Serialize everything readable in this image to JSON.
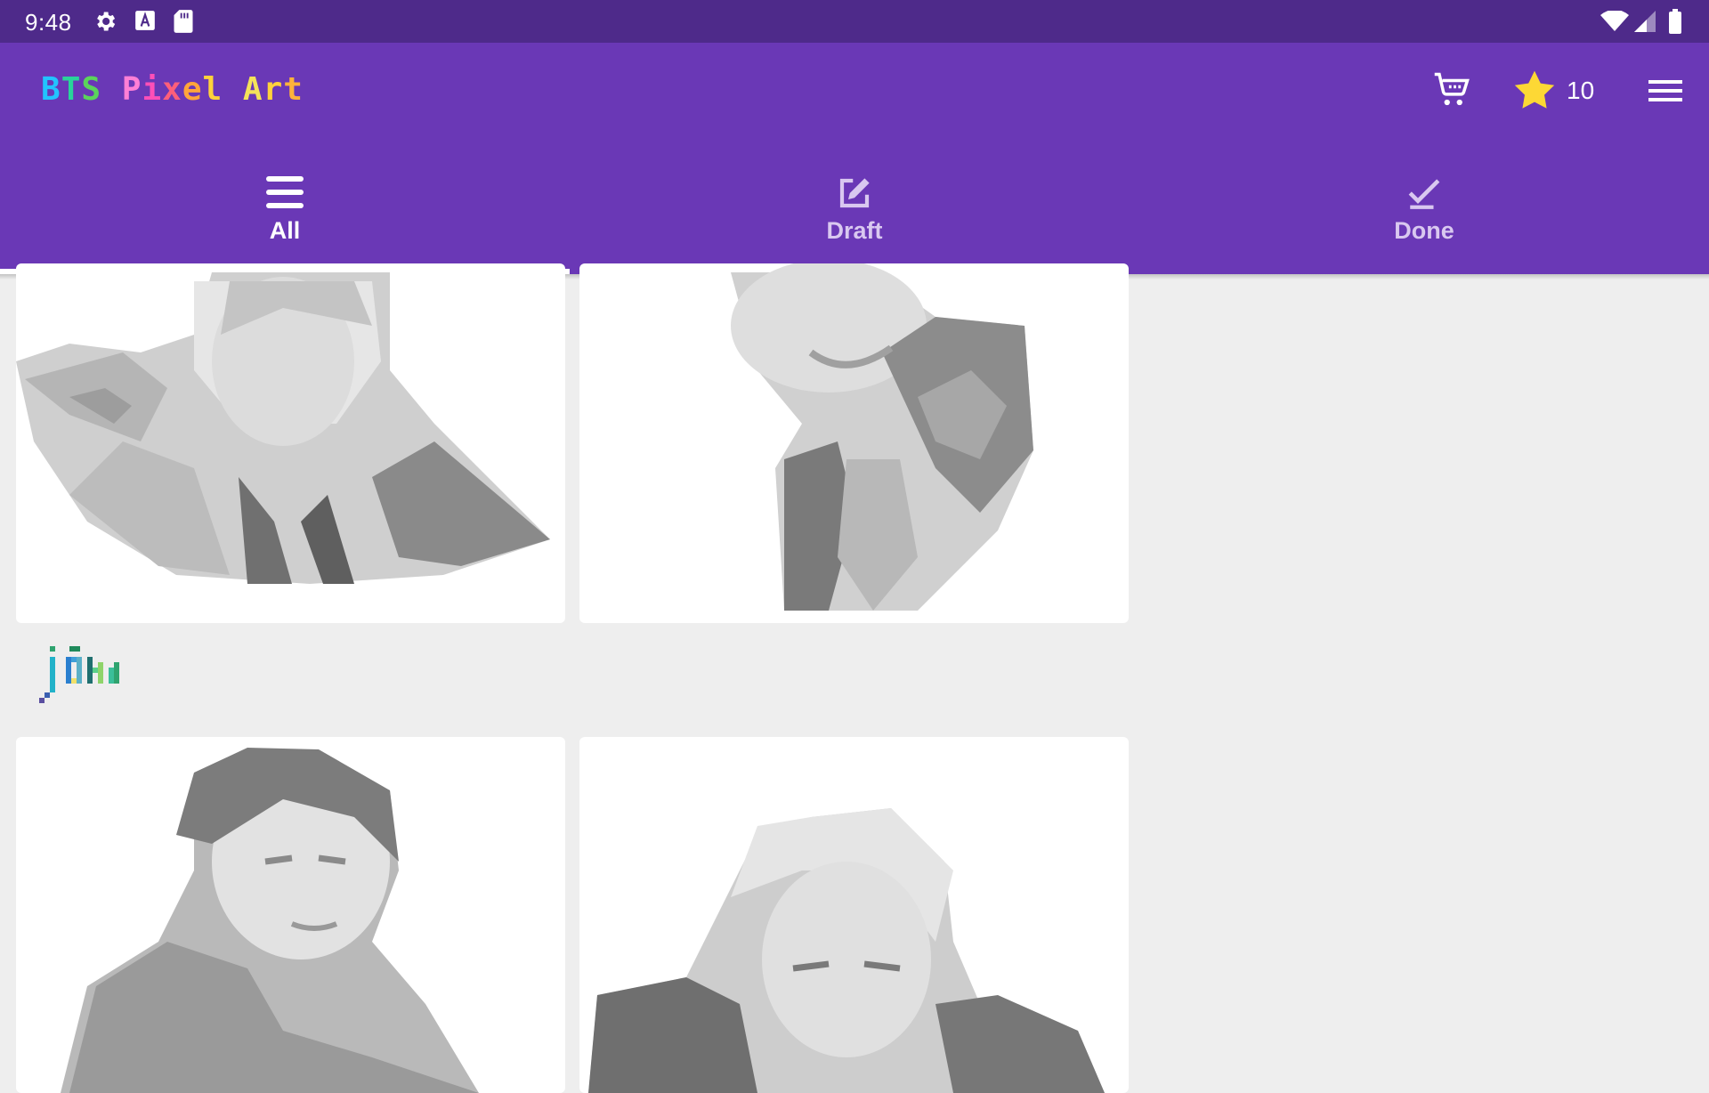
{
  "status_bar": {
    "time": "9:48",
    "icons": [
      "gear-icon",
      "font-a-icon",
      "sd-card-icon",
      "wifi-icon",
      "signal-icon",
      "battery-icon"
    ]
  },
  "app_bar": {
    "logo_text": "BTS Pixel Art",
    "star_count": "10",
    "icons": [
      "cart-icon",
      "star-icon",
      "menu-icon"
    ]
  },
  "tabs": [
    {
      "label": "All",
      "icon": "list-icon",
      "selected": true
    },
    {
      "label": "Draft",
      "icon": "edit-icon",
      "selected": false
    },
    {
      "label": "Done",
      "icon": "check-icon",
      "selected": false
    }
  ],
  "colors": {
    "status_bar": "#4e2a8a",
    "app_bar": "#6a38b6",
    "background": "#eeeeee",
    "star": "#fdd835"
  },
  "gallery": {
    "items": [
      {
        "type": "pixel-art-portrait",
        "state": "uncolored"
      },
      {
        "type": "pixel-art-portrait",
        "state": "uncolored"
      },
      {
        "type": "pixel-art-portrait",
        "state": "uncolored"
      },
      {
        "type": "pixel-art-portrait",
        "state": "uncolored"
      }
    ]
  }
}
